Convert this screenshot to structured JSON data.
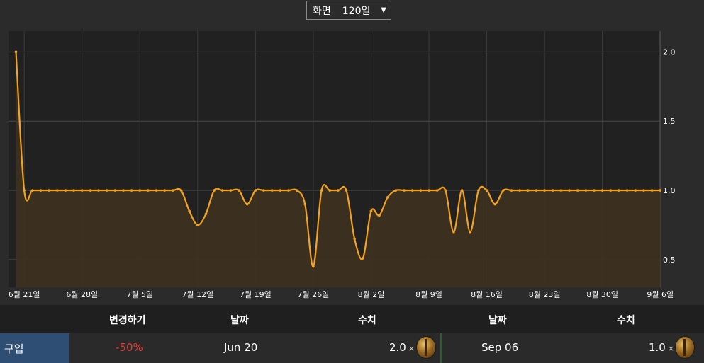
{
  "view_select": {
    "label": "화면",
    "value": "120일"
  },
  "chart_data": {
    "type": "area",
    "ylim": [
      0.3,
      2.15
    ],
    "yticks": [
      0.5,
      1.0,
      1.5,
      2.0
    ],
    "ytick_labels": [
      "0.5",
      "1.0",
      "1.5",
      "2.0"
    ],
    "grid": true,
    "x_start": "Jun 20",
    "xtick_labels": [
      {
        "label": "6월 21일",
        "date": "Jun 21"
      },
      {
        "label": "6월 28일",
        "date": "Jun 28"
      },
      {
        "label": "7월 5일",
        "date": "Jul 5"
      },
      {
        "label": "7월 12일",
        "date": "Jul 12"
      },
      {
        "label": "7월 19일",
        "date": "Jul 19"
      },
      {
        "label": "7월 26일",
        "date": "Jul 26"
      },
      {
        "label": "8월 2일",
        "date": "Aug 2"
      },
      {
        "label": "8월 9일",
        "date": "Aug 9"
      },
      {
        "label": "8월 16일",
        "date": "Aug 16"
      },
      {
        "label": "8월 23일",
        "date": "Aug 23"
      },
      {
        "label": "8월 30일",
        "date": "Aug 30"
      },
      {
        "label": "9월 6일",
        "date": "Sep 6"
      }
    ],
    "series": [
      {
        "color": "#f5a31a",
        "points": [
          {
            "date": "Jun 20",
            "value": 2.0
          },
          {
            "date": "Jun 21",
            "value": 1.0
          },
          {
            "date": "Jun 22",
            "value": 1.0
          },
          {
            "date": "Jun 23",
            "value": 1.0
          },
          {
            "date": "Jun 24",
            "value": 1.0
          },
          {
            "date": "Jun 25",
            "value": 1.0
          },
          {
            "date": "Jun 26",
            "value": 1.0
          },
          {
            "date": "Jun 27",
            "value": 1.0
          },
          {
            "date": "Jun 28",
            "value": 1.0
          },
          {
            "date": "Jun 29",
            "value": 1.0
          },
          {
            "date": "Jun 30",
            "value": 1.0
          },
          {
            "date": "Jul 1",
            "value": 1.0
          },
          {
            "date": "Jul 2",
            "value": 1.0
          },
          {
            "date": "Jul 3",
            "value": 1.0
          },
          {
            "date": "Jul 4",
            "value": 1.0
          },
          {
            "date": "Jul 5",
            "value": 1.0
          },
          {
            "date": "Jul 6",
            "value": 1.0
          },
          {
            "date": "Jul 7",
            "value": 1.0
          },
          {
            "date": "Jul 8",
            "value": 1.0
          },
          {
            "date": "Jul 9",
            "value": 1.0
          },
          {
            "date": "Jul 10",
            "value": 1.0
          },
          {
            "date": "Jul 11",
            "value": 0.85
          },
          {
            "date": "Jul 12",
            "value": 0.75
          },
          {
            "date": "Jul 13",
            "value": 0.83
          },
          {
            "date": "Jul 14",
            "value": 1.0
          },
          {
            "date": "Jul 15",
            "value": 1.0
          },
          {
            "date": "Jul 16",
            "value": 1.0
          },
          {
            "date": "Jul 17",
            "value": 1.0
          },
          {
            "date": "Jul 18",
            "value": 0.9
          },
          {
            "date": "Jul 19",
            "value": 1.0
          },
          {
            "date": "Jul 20",
            "value": 1.0
          },
          {
            "date": "Jul 21",
            "value": 1.0
          },
          {
            "date": "Jul 22",
            "value": 1.0
          },
          {
            "date": "Jul 23",
            "value": 1.0
          },
          {
            "date": "Jul 24",
            "value": 1.0
          },
          {
            "date": "Jul 25",
            "value": 0.9
          },
          {
            "date": "Jul 26",
            "value": 0.45
          },
          {
            "date": "Jul 27",
            "value": 1.0
          },
          {
            "date": "Jul 28",
            "value": 1.0
          },
          {
            "date": "Jul 29",
            "value": 1.0
          },
          {
            "date": "Jul 30",
            "value": 1.0
          },
          {
            "date": "Jul 31",
            "value": 0.65
          },
          {
            "date": "Aug 1",
            "value": 0.51
          },
          {
            "date": "Aug 2",
            "value": 0.85
          },
          {
            "date": "Aug 3",
            "value": 0.82
          },
          {
            "date": "Aug 4",
            "value": 0.95
          },
          {
            "date": "Aug 5",
            "value": 1.0
          },
          {
            "date": "Aug 6",
            "value": 1.0
          },
          {
            "date": "Aug 7",
            "value": 1.0
          },
          {
            "date": "Aug 8",
            "value": 1.0
          },
          {
            "date": "Aug 9",
            "value": 1.0
          },
          {
            "date": "Aug 10",
            "value": 1.0
          },
          {
            "date": "Aug 11",
            "value": 1.0
          },
          {
            "date": "Aug 12",
            "value": 0.7
          },
          {
            "date": "Aug 13",
            "value": 1.0
          },
          {
            "date": "Aug 14",
            "value": 0.7
          },
          {
            "date": "Aug 15",
            "value": 1.0
          },
          {
            "date": "Aug 16",
            "value": 1.0
          },
          {
            "date": "Aug 17",
            "value": 0.9
          },
          {
            "date": "Aug 18",
            "value": 1.0
          },
          {
            "date": "Aug 19",
            "value": 1.0
          },
          {
            "date": "Aug 20",
            "value": 1.0
          },
          {
            "date": "Aug 21",
            "value": 1.0
          },
          {
            "date": "Aug 22",
            "value": 1.0
          },
          {
            "date": "Aug 23",
            "value": 1.0
          },
          {
            "date": "Aug 24",
            "value": 1.0
          },
          {
            "date": "Aug 25",
            "value": 1.0
          },
          {
            "date": "Aug 26",
            "value": 1.0
          },
          {
            "date": "Aug 27",
            "value": 1.0
          },
          {
            "date": "Aug 28",
            "value": 1.0
          },
          {
            "date": "Aug 29",
            "value": 1.0
          },
          {
            "date": "Aug 30",
            "value": 1.0
          },
          {
            "date": "Aug 31",
            "value": 1.0
          },
          {
            "date": "Sep 1",
            "value": 1.0
          },
          {
            "date": "Sep 2",
            "value": 1.0
          },
          {
            "date": "Sep 3",
            "value": 1.0
          },
          {
            "date": "Sep 4",
            "value": 1.0
          },
          {
            "date": "Sep 5",
            "value": 1.0
          },
          {
            "date": "Sep 6",
            "value": 1.0
          }
        ]
      }
    ]
  },
  "table": {
    "headers": {
      "change": "변경하기",
      "date1": "날짜",
      "value1": "수치",
      "date2": "날짜",
      "value2": "수치"
    },
    "row": {
      "type": "구입",
      "change": "-50%",
      "date1": "Jun 20",
      "value1": "2.0",
      "times": "×",
      "currency_icon": "currency-orb-icon",
      "date2": "Sep 06",
      "value2": "1.0"
    }
  },
  "colors": {
    "line": "#f5a31a",
    "fill": "#3d3120",
    "negative": "#e53935",
    "row_type_bg": "#2e4f73"
  }
}
